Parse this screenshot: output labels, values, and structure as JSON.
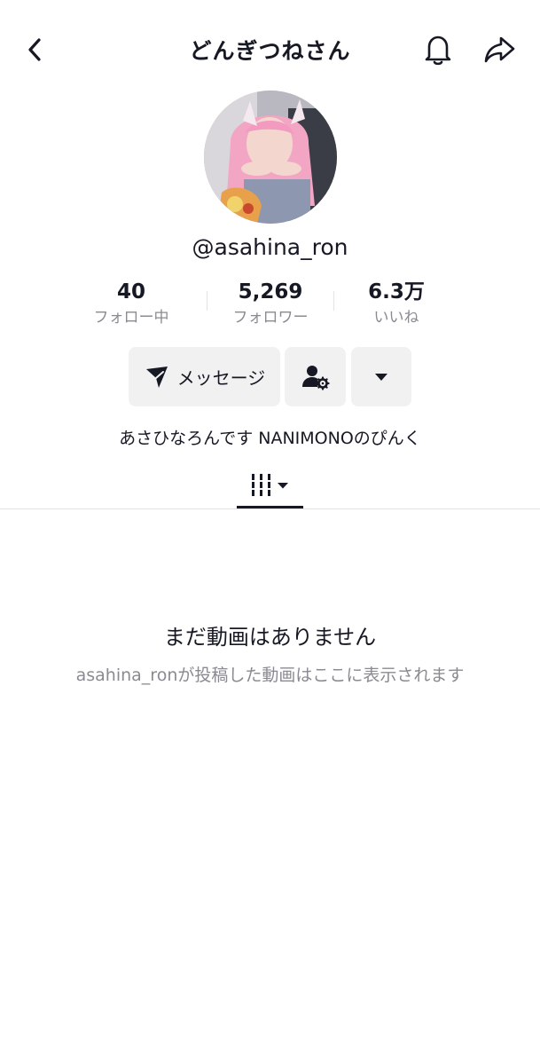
{
  "header": {
    "title": "どんぎつねさん",
    "back_icon": "chevron-left-icon",
    "bell_icon": "bell-icon",
    "share_icon": "share-icon"
  },
  "profile": {
    "username": "@asahina_ron",
    "bio": "あさひなろんです NANIMONOのぴんく"
  },
  "stats": [
    {
      "value": "40",
      "label": "フォロー中"
    },
    {
      "value": "5,269",
      "label": "フォロワー"
    },
    {
      "value": "6.3万",
      "label": "いいね"
    }
  ],
  "actions": {
    "message_label": "メッセージ",
    "message_icon": "send-icon",
    "friend_icon": "user-settings-icon",
    "more_icon": "caret-down-icon"
  },
  "tabs": {
    "videos_icon": "grid-icon"
  },
  "empty": {
    "title": "まだ動画はありません",
    "subtitle": "asahina_ronが投稿した動画はここに表示されます"
  }
}
